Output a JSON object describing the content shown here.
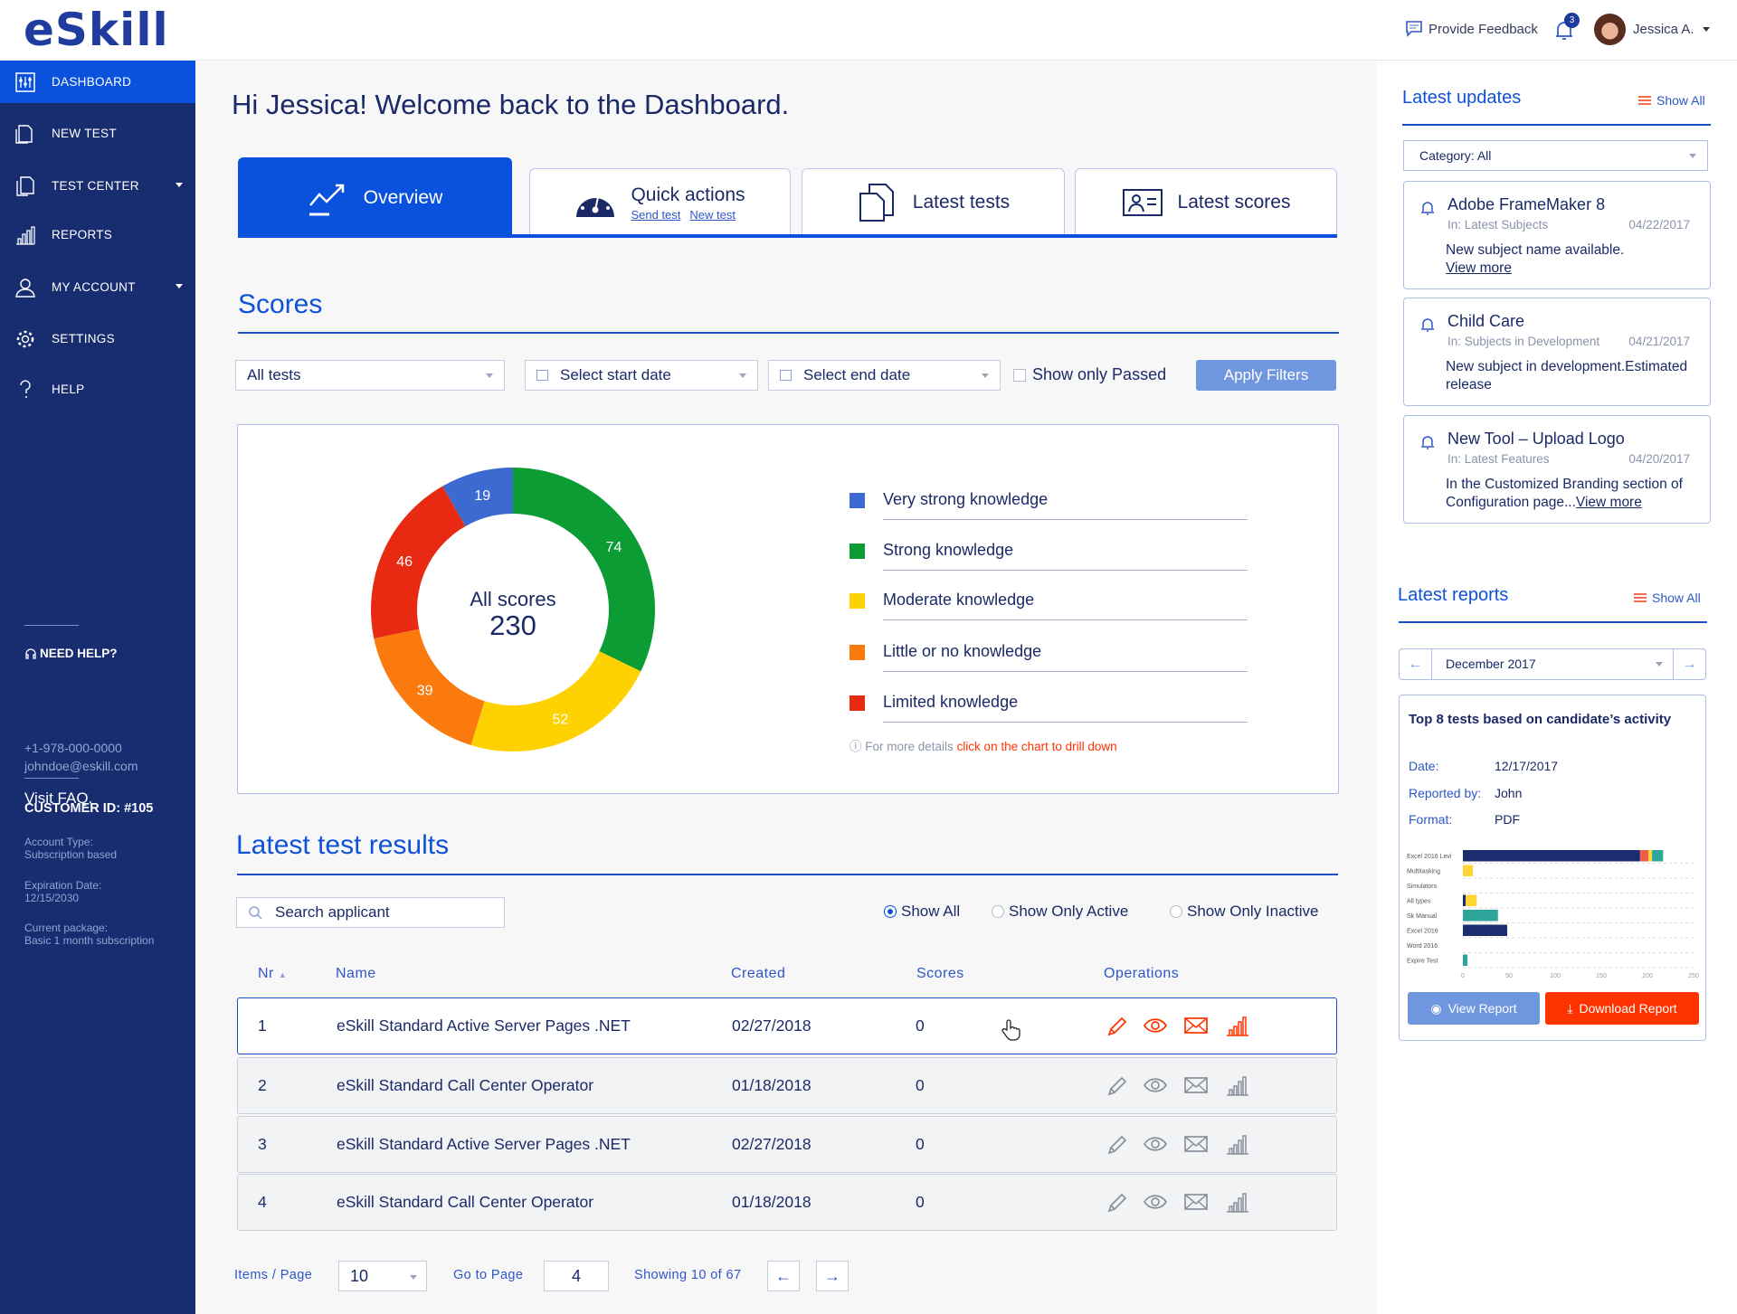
{
  "header": {
    "logo": "eSkill",
    "feedback": "Provide Feedback",
    "notification_count": "3",
    "user_name": "Jessica A."
  },
  "sidebar": {
    "items": [
      {
        "label": "DASHBOARD",
        "icon": "dashboard-icon",
        "active": true
      },
      {
        "label": "NEW TEST",
        "icon": "new-test-icon"
      },
      {
        "label": "TEST CENTER",
        "icon": "test-center-icon",
        "has_caret": true
      },
      {
        "label": "REPORTS",
        "icon": "reports-icon"
      },
      {
        "label": "MY ACCOUNT",
        "icon": "account-icon",
        "has_caret": true
      },
      {
        "label": "SETTINGS",
        "icon": "gear-icon"
      },
      {
        "label": "HELP",
        "icon": "help-icon"
      }
    ],
    "help": {
      "title": "NEED HELP?",
      "phone": "+1-978-000-0000",
      "email": "johndoe@eskill.com",
      "faq": "Visit FAQ."
    },
    "customer": {
      "id": "CUSTOMER ID: #105",
      "account_type_label": "Account Type:",
      "account_type": "Subscription based",
      "expiration_label": "Expiration Date:",
      "expiration": "12/15/2030",
      "package_label": "Current package:",
      "package": "Basic 1 month subscription"
    }
  },
  "main": {
    "title": "Hi Jessica! Welcome back to the Dashboard.",
    "tabs": {
      "overview": "Overview",
      "quick_actions": "Quick actions",
      "send_test": "Send test",
      "new_test": "New test",
      "latest_tests": "Latest tests",
      "latest_scores": "Latest scores"
    },
    "scores": {
      "title": "Scores",
      "filter_tests": "All tests",
      "start_date": "Select start date",
      "end_date": "Select end date",
      "show_passed": "Show only Passed",
      "apply": "Apply Filters",
      "center_label": "All scores",
      "center_total": "230",
      "note_prefix": "For more details ",
      "note_link": "click on the chart to drill down"
    },
    "results": {
      "title": "Latest test results",
      "search_placeholder": "Search applicant",
      "radios": [
        "Show All",
        "Show Only Active",
        "Show Only Inactive"
      ],
      "radio_selected": 0,
      "columns": [
        "Nr",
        "Name",
        "Created",
        "Scores",
        "Operations"
      ],
      "rows": [
        {
          "nr": "1",
          "name": "eSkill Standard Active Server Pages .NET",
          "created": "02/27/2018",
          "scores": "0"
        },
        {
          "nr": "2",
          "name": "eSkill Standard Call Center Operator",
          "created": "01/18/2018",
          "scores": "0"
        },
        {
          "nr": "3",
          "name": "eSkill Standard Active Server Pages .NET",
          "created": "02/27/2018",
          "scores": "0"
        },
        {
          "nr": "4",
          "name": "eSkill Standard Call Center Operator",
          "created": "01/18/2018",
          "scores": "0"
        }
      ],
      "pagination": {
        "items_label": "Items / Page",
        "items_value": "10",
        "goto_label": "Go to Page",
        "goto_value": "4",
        "showing": "Showing 10 of 67"
      }
    }
  },
  "chart_data": [
    {
      "type": "pie",
      "donut": true,
      "title": "",
      "categories": [
        "Very strong knowledge",
        "Strong knowledge",
        "Moderate knowledge",
        "Little or no knowledge",
        "Limited knowledge"
      ],
      "values": [
        19,
        74,
        52,
        39,
        46
      ],
      "colors": [
        "#3d6ad0",
        "#0c9c34",
        "#fdd200",
        "#fb7a0e",
        "#e92a12"
      ],
      "legend": "right"
    },
    {
      "type": "bar",
      "stacked": true,
      "orientation": "horizontal",
      "categories": [
        "Excel 2016 Levi",
        "Multitasking",
        "Simulators",
        "All types",
        "Sk Manual",
        "Excel 2016",
        "Word 2016",
        "Expire Test"
      ],
      "xlim": [
        0,
        250
      ],
      "xticks": [
        "0",
        "50",
        "100",
        "150",
        "200",
        "250"
      ],
      "grid": true,
      "series": [
        {
          "color": "#1b2d6e",
          "values": [
            192,
            0,
            0,
            3,
            0,
            48,
            0,
            0
          ]
        },
        {
          "color": "#ee5c4a",
          "values": [
            9,
            0,
            0,
            0,
            0,
            0,
            0,
            0
          ]
        },
        {
          "color": "#fdd535",
          "values": [
            4,
            11,
            0,
            12,
            0,
            0,
            0,
            0
          ]
        },
        {
          "color": "#2ea59a",
          "values": [
            12,
            0,
            0,
            0,
            38,
            0,
            0,
            5
          ]
        }
      ]
    }
  ],
  "right": {
    "updates": {
      "title": "Latest updates",
      "show_all": "Show All",
      "category": "Category: All",
      "items": [
        {
          "title": "Adobe FrameMaker 8",
          "in": "In: Latest Subjects",
          "date": "04/22/2017",
          "body": "New subject name available.",
          "link": "View more"
        },
        {
          "title": "Child Care",
          "in": "In: Subjects in Development",
          "date": "04/21/2017",
          "body": "New subject in development.Estimated release",
          "link": ""
        },
        {
          "title": "New Tool – Upload Logo",
          "in": "In: Latest Features",
          "date": "04/20/2017",
          "body": "In the Customized Branding section of Configuration page...",
          "link": "View more"
        }
      ]
    },
    "reports": {
      "title": "Latest reports",
      "show_all": "Show All",
      "month": "December 2017",
      "card_title": "Top 8 tests based on candidate’s activity",
      "date_label": "Date:",
      "date": "12/17/2017",
      "by_label": "Reported by:",
      "by": "John",
      "format_label": "Format:",
      "format": "PDF",
      "view": "View Report",
      "download": "Download Report"
    }
  },
  "colors": {
    "brand": "#0a52de",
    "sidebar": "#172d70",
    "download": "#ff3300",
    "view": "#6f97e0"
  }
}
